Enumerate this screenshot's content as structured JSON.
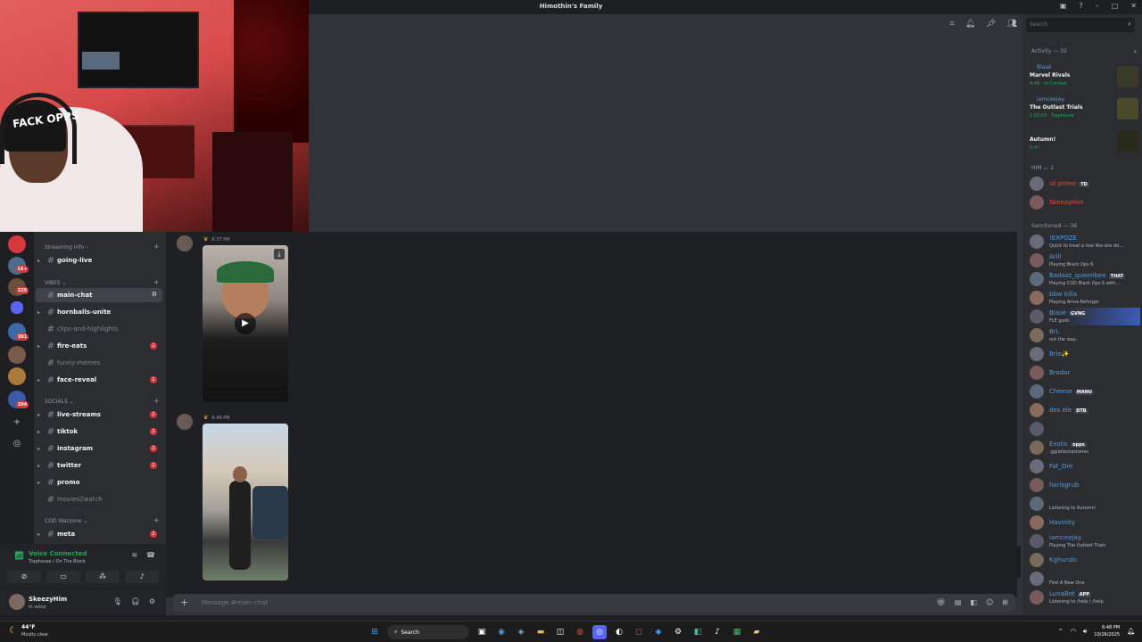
{
  "window": {
    "title": "Himothin's Family"
  },
  "webcam": {
    "cap_text": "FACK OPPS"
  },
  "guilds": [
    {
      "badge": "16+"
    },
    {
      "badge": "335"
    },
    {
      "badge": ""
    },
    {
      "badge": "301"
    },
    {
      "badge": ""
    },
    {
      "badge": "204"
    }
  ],
  "channels": {
    "categories": [
      {
        "label": "Streaming info"
      },
      {
        "label": "VIBES"
      },
      {
        "label": "SOCIALS"
      },
      {
        "label": "COD Warzone"
      }
    ],
    "items": [
      {
        "name": "going-live",
        "muted": false,
        "badge": ""
      },
      {
        "name": "main-chat",
        "muted": false,
        "badge": ""
      },
      {
        "name": "hornballs-unite",
        "muted": false,
        "badge": ""
      },
      {
        "name": "clips-and-highlights",
        "muted": true,
        "badge": ""
      },
      {
        "name": "fire-eats",
        "muted": false,
        "badge": "2"
      },
      {
        "name": "funny-memes",
        "muted": true,
        "badge": ""
      },
      {
        "name": "face-reveal",
        "muted": false,
        "badge": "2"
      },
      {
        "name": "live-streams",
        "muted": false,
        "badge": "2"
      },
      {
        "name": "tiktok",
        "muted": false,
        "badge": "2"
      },
      {
        "name": "instagram",
        "muted": false,
        "badge": "2"
      },
      {
        "name": "twitter",
        "muted": false,
        "badge": "2"
      },
      {
        "name": "promo",
        "muted": false,
        "badge": ""
      },
      {
        "name": "movies2watch",
        "muted": true,
        "badge": ""
      },
      {
        "name": "meta",
        "muted": false,
        "badge": "2"
      }
    ]
  },
  "voice": {
    "status": "Voice Connected",
    "location": "Traphouse / On The Block"
  },
  "user": {
    "name": "SkeezyHim",
    "status": "In voice"
  },
  "messages": [
    {
      "time": "6:37 PM"
    },
    {
      "time": "6:46 PM"
    }
  ],
  "composer": {
    "placeholder": "Message #main-chat"
  },
  "search": {
    "placeholder": "Search"
  },
  "activity": {
    "header": "Activity — 32",
    "items": [
      {
        "user": "Blasé",
        "game": "Marvel Rivals",
        "detail": "4:49 · In Combat"
      },
      {
        "user": "iamceejay.",
        "game": "The Outlast Trials",
        "detail": "1:02:03 · Traphouse"
      },
      {
        "user": "",
        "game": "Autumn!",
        "detail": "0:47"
      }
    ]
  },
  "member_sections": [
    {
      "label": "HIM — 2"
    },
    {
      "label": "Sanctioned — 36"
    }
  ],
  "members_him": [
    {
      "name": "izi prime",
      "status": "",
      "tag": "TD",
      "color": "#e74c3c"
    },
    {
      "name": "SkeezyHim",
      "status": "",
      "tag": "",
      "color": "#e74c3c"
    }
  ],
  "members_sanctioned": [
    {
      "name": "!EXPOZE",
      "status": "Quick to treat a hoe like she do...",
      "tag": "",
      "color": "#5b9bd5"
    },
    {
      "name": "Arill",
      "status": "Playing Black Ops 6",
      "tag": "",
      "color": "#5b9bd5"
    },
    {
      "name": "Badazz_queenbee",
      "status": "Playing COD Black Ops 6 with...",
      "tag": "THAT",
      "color": "#5b9bd5"
    },
    {
      "name": "bbw killa",
      "status": "Playing Arma Reforger",
      "tag": "",
      "color": "#5b9bd5"
    },
    {
      "name": "Blasé",
      "status": "FLE gods",
      "tag": "GVNG",
      "color": "#5b9bd5"
    },
    {
      "name": "Bri.",
      "status": "out the way..",
      "tag": "",
      "color": "#5b9bd5"
    },
    {
      "name": "Brie✨",
      "status": "",
      "tag": "",
      "color": "#5b9bd5"
    },
    {
      "name": "Brodor",
      "status": "",
      "tag": "",
      "color": "#5b9bd5"
    },
    {
      "name": "Cheese",
      "status": "",
      "tag": "MANU",
      "color": "#5b9bd5"
    },
    {
      "name": "des ele",
      "status": "",
      "tag": "DTB",
      "color": "#5b9bd5"
    },
    {
      "name": "",
      "status": "",
      "tag": "",
      "color": "#e74c3c"
    },
    {
      "name": "Exotic",
      "status": ".gg/atlantastories",
      "tag": "opps",
      "color": "#5b9bd5"
    },
    {
      "name": "Fat_Dre",
      "status": "",
      "tag": "",
      "color": "#5b9bd5"
    },
    {
      "name": "foirisgrub",
      "status": "",
      "tag": "",
      "color": "#5b9bd5"
    },
    {
      "name": "",
      "status": "Listening to Autumn!",
      "tag": "",
      "color": "#5b9bd5"
    },
    {
      "name": "Havinity",
      "status": "",
      "tag": "",
      "color": "#5b9bd5"
    },
    {
      "name": "iamceejay.",
      "status": "Playing The Outlast Trials",
      "tag": "",
      "color": "#5b9bd5"
    },
    {
      "name": "Kghundo",
      "status": "",
      "tag": "",
      "color": "#5b9bd5"
    },
    {
      "name": "",
      "status": "Find A New One",
      "tag": "",
      "color": "#e74c3c"
    },
    {
      "name": "LunaBot",
      "status": "Listening to /help | /help",
      "tag": "APP",
      "color": "#5b9bd5"
    }
  ],
  "taskbar": {
    "temp": "44°F",
    "condition": "Mostly clear",
    "search": "Search",
    "time": "6:48 PM",
    "date": "10/26/2025"
  },
  "colors": {
    "accent": "#5865f2",
    "online": "#23a55a",
    "danger": "#da373c"
  }
}
